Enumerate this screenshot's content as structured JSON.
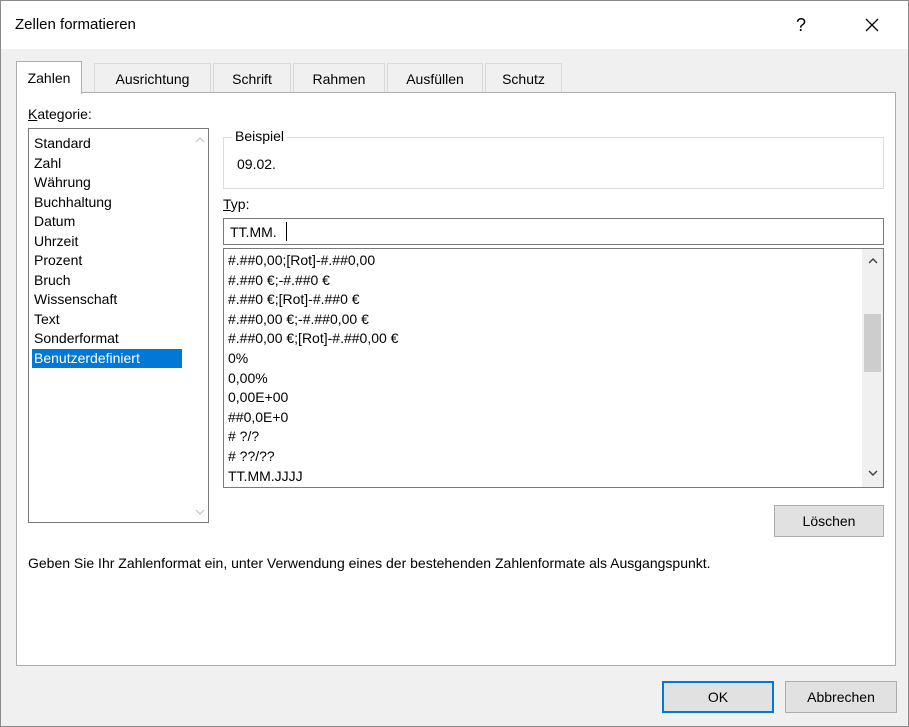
{
  "dialog": {
    "title": "Zellen formatieren",
    "help_label": "?",
    "accent_color": "#0078d7"
  },
  "tabs": [
    {
      "label": "Zahlen",
      "active": true
    },
    {
      "label": "Ausrichtung"
    },
    {
      "label": "Schrift"
    },
    {
      "label": "Rahmen"
    },
    {
      "label": "Ausfüllen"
    },
    {
      "label": "Schutz"
    }
  ],
  "category": {
    "label": "Kategorie:",
    "items": [
      "Standard",
      "Zahl",
      "Währung",
      "Buchhaltung",
      "Datum",
      "Uhrzeit",
      "Prozent",
      "Bruch",
      "Wissenschaft",
      "Text",
      "Sonderformat",
      "Benutzerdefiniert"
    ],
    "selected": "Benutzerdefiniert"
  },
  "sample": {
    "label": "Beispiel",
    "value": "09.02."
  },
  "type": {
    "label": "Typ:",
    "value": "TT.MM."
  },
  "formats": [
    "#.##0,00;[Rot]-#.##0,00",
    "#.##0 €;-#.##0 €",
    "#.##0 €;[Rot]-#.##0 €",
    "#.##0,00 €;-#.##0,00 €",
    "#.##0,00 €;[Rot]-#.##0,00 €",
    "0%",
    "0,00%",
    "0,00E+00",
    "##0,0E+0",
    "# ?/?",
    "# ??/??",
    "TT.MM.JJJJ"
  ],
  "buttons": {
    "delete": "Löschen",
    "ok": "OK",
    "cancel": "Abbrechen"
  },
  "hint": "Geben Sie Ihr Zahlenformat ein, unter Verwendung eines der bestehenden Zahlenformate als Ausgangspunkt."
}
